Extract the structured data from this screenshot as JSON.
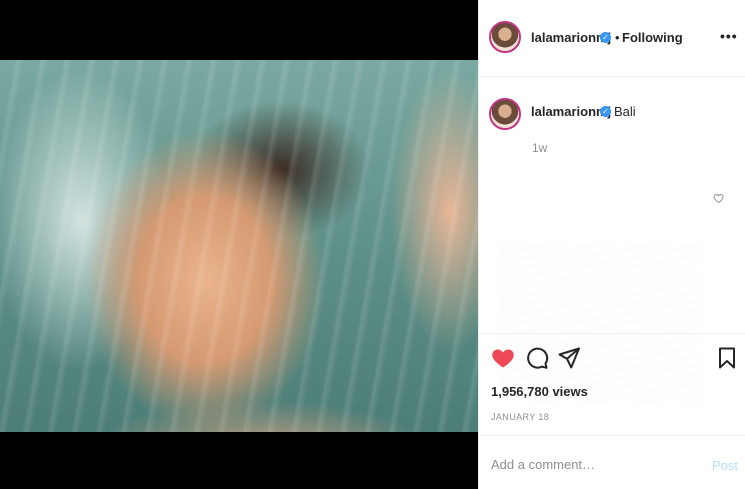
{
  "post": {
    "account": {
      "username": "lalamarionmj",
      "verified": true
    },
    "header": {
      "separator": "•",
      "follow_status": "Following",
      "more_label": "•••"
    },
    "caption": {
      "username": "lalamarionmj",
      "location": "Bali",
      "time_ago": "1w"
    },
    "stats": {
      "views": "1,956,780 views",
      "date": "JANUARY 18"
    },
    "comment_box": {
      "placeholder": "Add a comment…",
      "post_label": "Post"
    },
    "icons": {
      "like": "heart-icon",
      "comment": "comment-icon",
      "share": "share-icon",
      "save": "bookmark-icon",
      "small_like": "heart-outline-icon"
    },
    "colors": {
      "like": "#ed4956",
      "post_disabled": "#b2dffc",
      "verified": "#3897f0"
    }
  }
}
